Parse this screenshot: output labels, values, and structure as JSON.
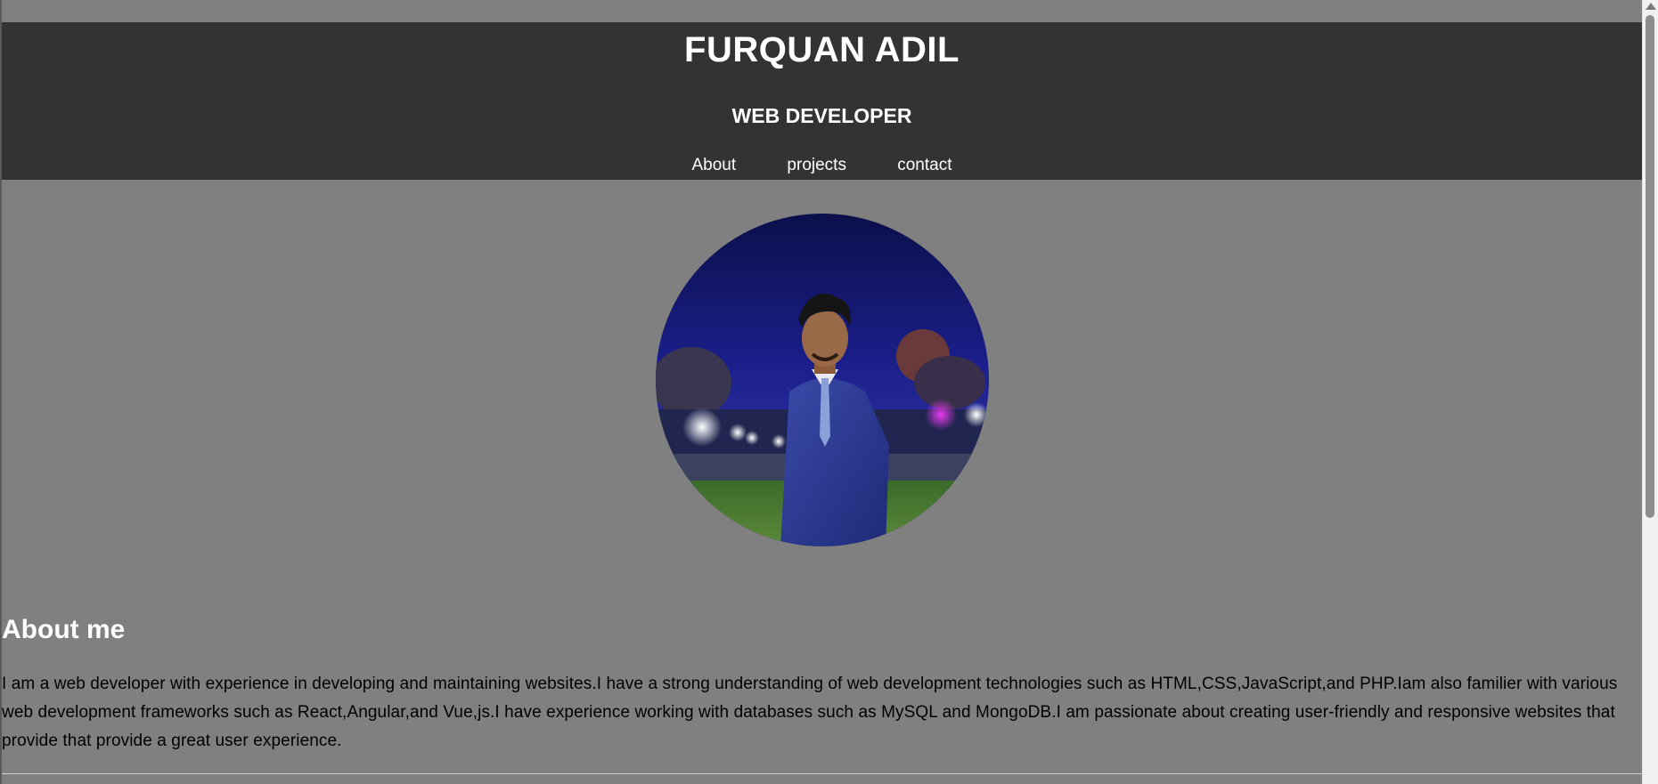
{
  "header": {
    "title": "FURQUAN ADIL",
    "subtitle": "WEB DEVELOPER"
  },
  "nav": {
    "items": [
      {
        "label": "About"
      },
      {
        "label": "projects"
      },
      {
        "label": "contact"
      }
    ]
  },
  "about": {
    "heading": "About me",
    "paragraph": "I am a web developer with experience in developing and maintaining websites.I have a strong understanding of web development technologies such as HTML,CSS,JavaScript,and PHP.Iam also familier with various web development frameworks such as React,Angular,and Vue,js.I have experience working with databases such as MySQL and MongoDB.I am passionate about creating user-friendly and responsive websites that provide that provide a great user experience."
  },
  "colors": {
    "page_background": "#808080",
    "header_background": "#333333",
    "header_text": "#ffffff",
    "body_text": "#000000"
  },
  "icons": {
    "scroll_up": "scroll-up-arrow-icon"
  }
}
